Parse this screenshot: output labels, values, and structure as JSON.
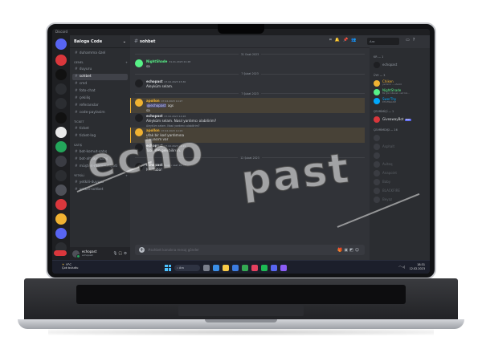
{
  "window": {
    "title": "Discord"
  },
  "server": {
    "name": "Baloga Code"
  },
  "channels": {
    "pinned": "duhamma özel",
    "categories": [
      {
        "name": "GENEL",
        "items": [
          "duyuru",
          "sohbet",
          "cmd",
          "foto-chat",
          "çekiliş",
          "referanslar",
          "code-paylasim"
        ]
      },
      {
        "name": "TICKET",
        "items": [
          "ticket",
          "ticket-log"
        ]
      },
      {
        "name": "SATIŞ",
        "items": [
          "bot-komut-satış",
          "bot-altyapı-satış",
          "müşteri-memnuniyeti"
        ]
      },
      {
        "name": "YETKİLİ",
        "items": [
          "yetkili-duyuru",
          "yetkili-sohbet"
        ]
      }
    ],
    "active": "sohbet"
  },
  "user_panel": {
    "name": "echopast",
    "status": "echopast"
  },
  "chat": {
    "channel": "sohbet",
    "search_placeholder": "Ara",
    "composer_placeholder": "#sohbet kanalına mesaj gönder",
    "dividers": [
      "31 Ocak 2023",
      "7 Şubat 2023",
      "7 Şubat 2023",
      "12 Şubat 2023"
    ],
    "messages": [
      {
        "author": "NightShade",
        "time": "31.01.2023 21:28",
        "text": "sa",
        "color": "#57f287"
      },
      {
        "author": "echopast",
        "time": "07.02.2023 15:30",
        "text": "Aleyküm selam.",
        "color": "#dbdee1"
      },
      {
        "author": "apollon",
        "time": "07.02.2023 14:27",
        "mention": "@echopast",
        "text": "ags",
        "text2": "sa",
        "color": "#f0b232"
      },
      {
        "author": "echopast",
        "time": "07.02.2023 14:28",
        "text": "Aleyküm selam. Nasıl yardımcı olabilirim?",
        "color": "#dbdee1"
      },
      {
        "reply": "Aleyküm selam. Nasıl yardımcı olabilirim?",
        "author": "apollon",
        "time": "07.02.2023 14:29",
        "text": "ufak bir kod yardımına",
        "text2": "ihtiyacım var",
        "color": "#f0b232"
      },
      {
        "author": "echopast",
        "time": "07.02.2023 14:29",
        "text": "Tabi, dm gelebilirsin.",
        "color": "#dbdee1"
      },
      {
        "author": "echopast",
        "time": "bugün saat 18:34",
        "text": "Merhaba!",
        "color": "#dbdee1"
      }
    ]
  },
  "members": {
    "groups": [
      {
        "title": "KR — 1",
        "items": [
          {
            "name": "echopast",
            "status": ""
          }
        ]
      },
      {
        "title": "ÜYE — 3",
        "items": [
          {
            "name": "Chiken",
            "status": "yardımcı — sharkil",
            "color": "#f0b232"
          },
          {
            "name": "NightShade",
            "status": "Bir gün bitecek, vart biz…",
            "color": "#57f287"
          },
          {
            "name": "SwerThy",
            "status": "KTS ENGLISH",
            "color": "#00a8fc"
          }
        ]
      },
      {
        "title": "ÇEVRİMİÇİ — 1",
        "items": [
          {
            "name": "GiveawayBot",
            "status": "",
            "bot": "BOT"
          }
        ]
      },
      {
        "title": "ÇEVRİMDIŞI — 16",
        "items": [
          {
            "name": ""
          },
          {
            "name": "Asphalt"
          },
          {
            "name": ""
          },
          {
            "name": "Aviteq"
          },
          {
            "name": "Anapoint"
          },
          {
            "name": "Baby"
          },
          {
            "name": "BLACKFIRE"
          },
          {
            "name": "Beyaz"
          }
        ]
      }
    ]
  },
  "taskbar": {
    "weather_temp": "9°C",
    "weather_text": "Çok bulutlu",
    "search_label": "Ara",
    "time": "18:31",
    "date": "12.02.2023"
  },
  "watermark": {
    "left": "echo",
    "right": "past"
  },
  "colors": {
    "accent": "#5865f2",
    "online": "#23a55a",
    "mention": "#f0b232"
  }
}
